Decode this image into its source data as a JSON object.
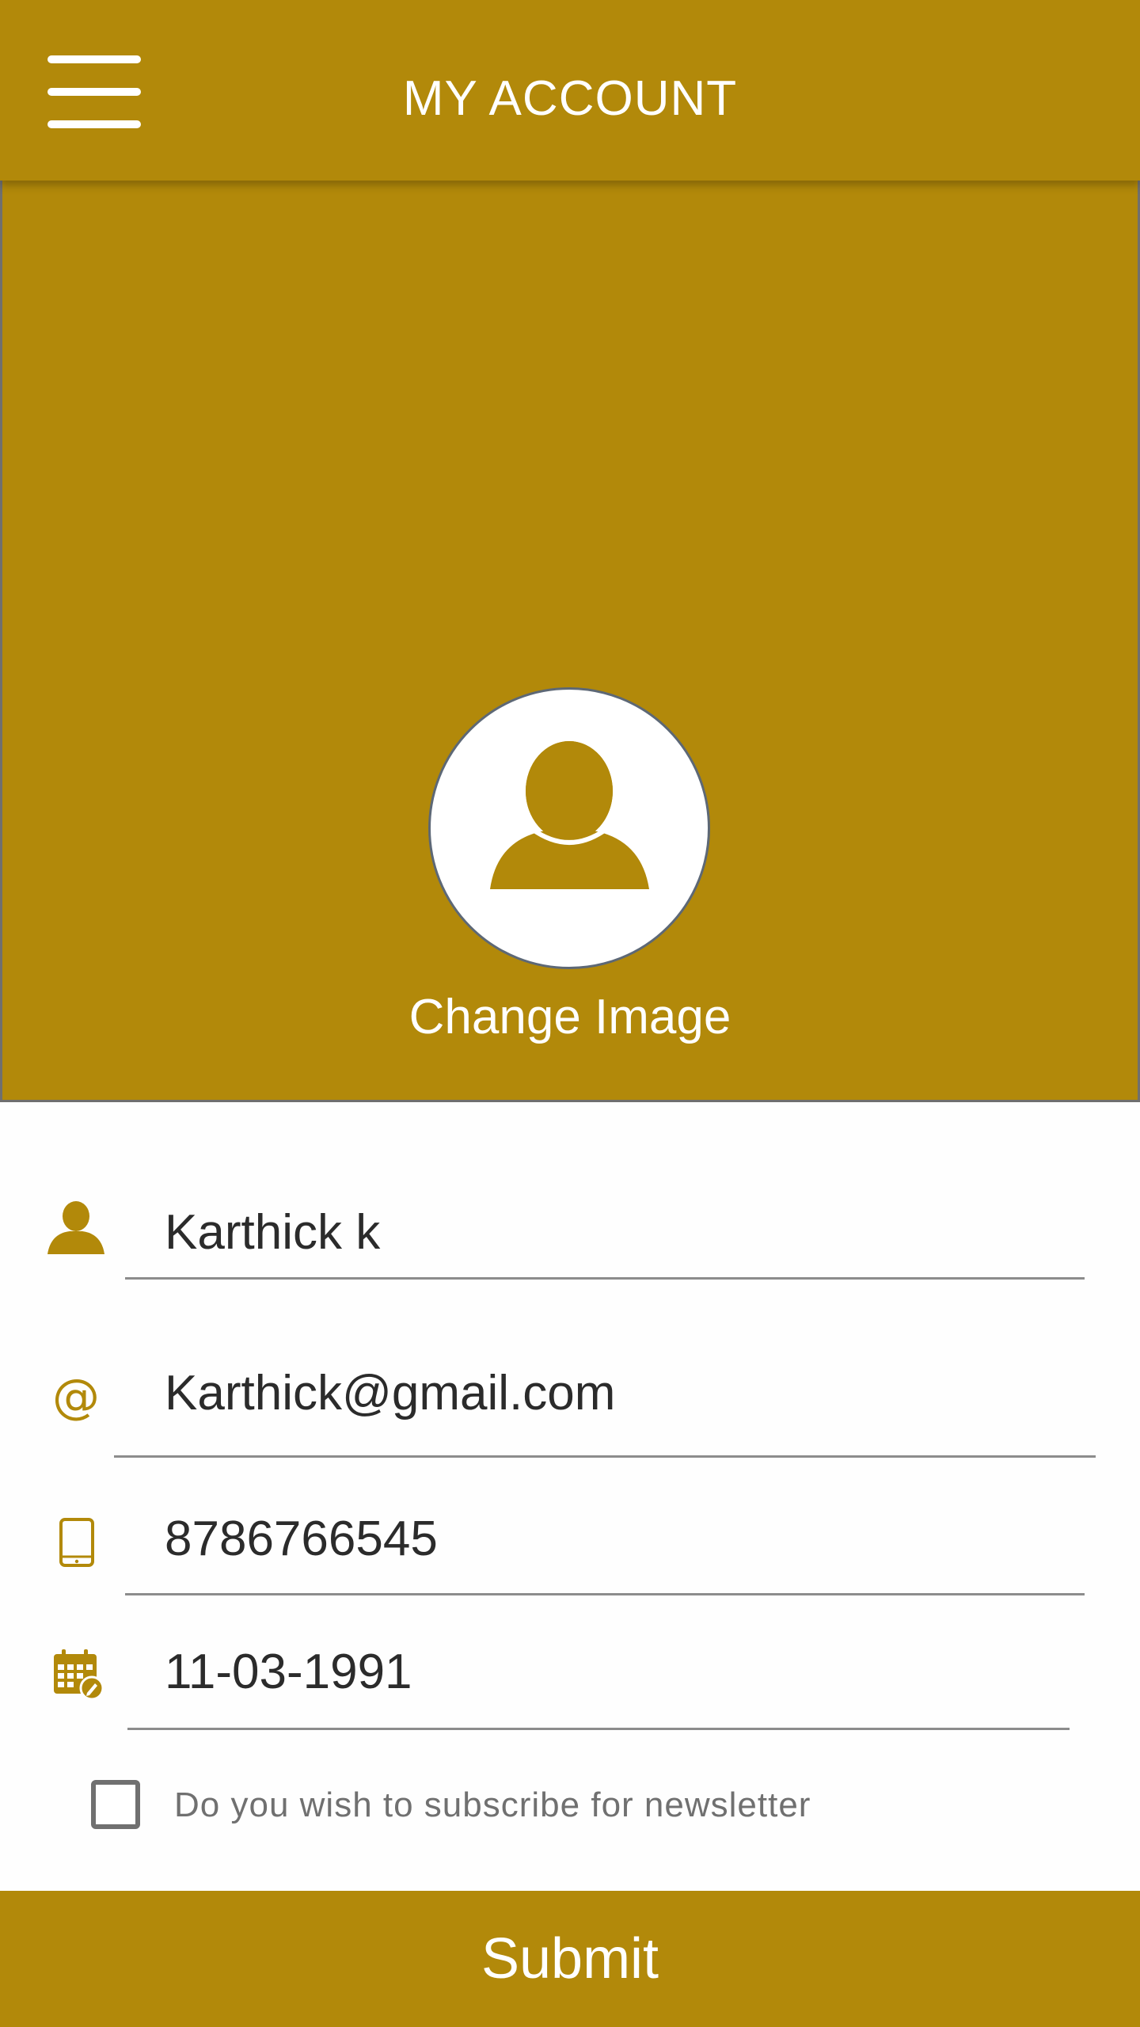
{
  "header": {
    "title": "MY ACCOUNT",
    "menu_icon": "hamburger-menu-icon"
  },
  "profile": {
    "avatar_icon": "user-silhouette-icon",
    "change_image_label": "Change Image"
  },
  "form": {
    "name": {
      "icon": "person-icon",
      "value": "Karthick k"
    },
    "email": {
      "icon": "at-sign-icon",
      "value": "Karthick@gmail.com"
    },
    "phone": {
      "icon": "mobile-phone-icon",
      "value": "8786766545"
    },
    "dob": {
      "icon": "calendar-edit-icon",
      "value": "11-03-1991"
    },
    "newsletter": {
      "label": "Do you wish to subscribe for newsletter",
      "checked": false
    }
  },
  "submit_label": "Submit",
  "colors": {
    "accent": "#b2890a",
    "text": "#2b2b2b",
    "muted": "#707070",
    "divider": "#8c8c8c"
  }
}
